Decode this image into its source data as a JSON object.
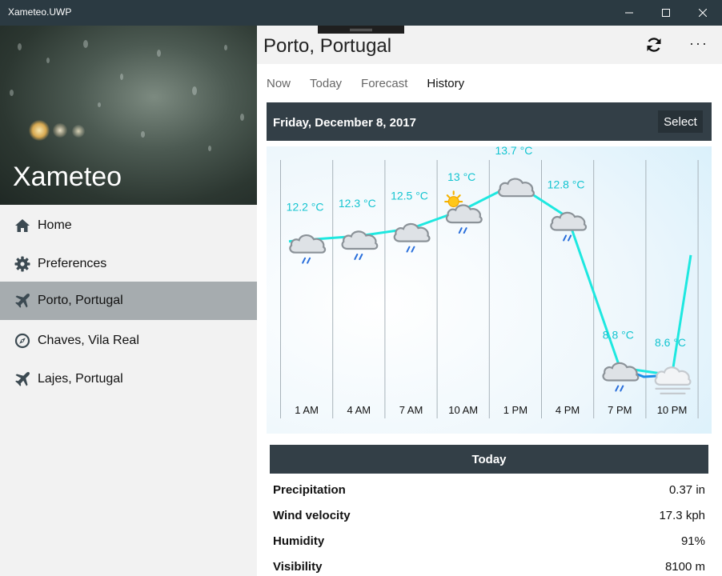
{
  "window": {
    "title": "Xameteo.UWP"
  },
  "sidebar": {
    "app_name": "Xameteo",
    "items": [
      {
        "label": "Home",
        "icon": "home-icon"
      },
      {
        "label": "Preferences",
        "icon": "gear-icon"
      },
      {
        "label": "Porto, Portugal",
        "icon": "airplane-icon",
        "selected": true
      },
      {
        "label": "Chaves, Vila Real",
        "icon": "compass-icon"
      },
      {
        "label": "Lajes, Portugal",
        "icon": "airplane-icon"
      }
    ]
  },
  "header": {
    "title": "Porto, Portugal",
    "refresh_icon": "refresh-icon",
    "more_label": "···"
  },
  "tabs": [
    {
      "label": "Now"
    },
    {
      "label": "Today"
    },
    {
      "label": "Forecast"
    },
    {
      "label": "History",
      "active": true
    }
  ],
  "date_bar": {
    "date": "Friday, December 8, 2017",
    "select_label": "Select"
  },
  "chart_data": {
    "type": "line",
    "x": [
      "1 AM",
      "4 AM",
      "7 AM",
      "10 AM",
      "1 PM",
      "4 PM",
      "7 PM",
      "10 PM"
    ],
    "series": [
      {
        "values": [
          12.2,
          12.3,
          12.5,
          13,
          13.7,
          12.8,
          8.8,
          8.6
        ]
      }
    ],
    "labels": [
      "12.2 °C",
      "12.3 °C",
      "12.5 °C",
      "13 °C",
      "13.7 °C",
      "12.8 °C",
      "8.8 °C",
      "8.6 °C"
    ],
    "conditions": [
      "rain",
      "rain",
      "rain",
      "partly-sunny-rain",
      "cloudy",
      "rain",
      "rain",
      "fog"
    ],
    "line_color": "#1ee8e0",
    "label_color": "#13c4d0",
    "grid": true
  },
  "summary": {
    "title": "Today",
    "rows": [
      {
        "label": "Precipitation",
        "value": "0.37 in"
      },
      {
        "label": "Wind velocity",
        "value": "17.3 kph"
      },
      {
        "label": "Humidity",
        "value": "91%"
      },
      {
        "label": "Visibility",
        "value": "8100 m"
      }
    ]
  },
  "colors": {
    "titlebar": "#2b3a42",
    "dark_bar": "#333f47",
    "selected_nav": "#a6acaf"
  }
}
